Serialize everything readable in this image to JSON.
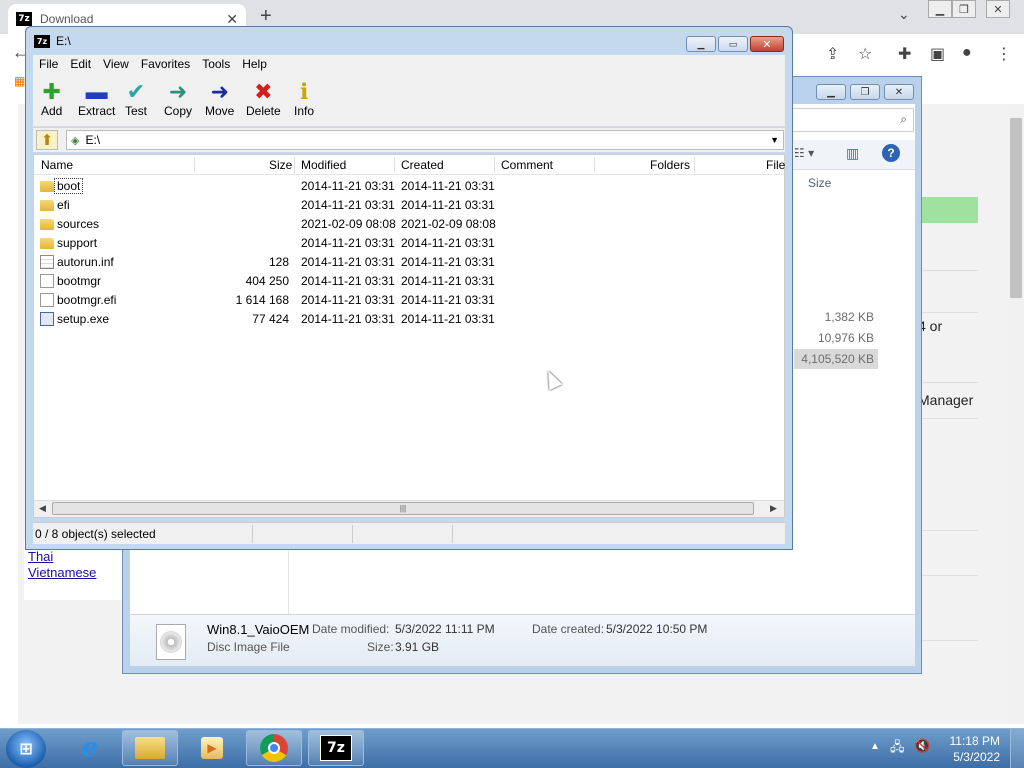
{
  "browser": {
    "tab_title": "Download",
    "tab_icon_text": "7z",
    "close_glyph": "✕",
    "new_tab_glyph": "+",
    "chevron_glyph": "⌄",
    "back_glyph": "←"
  },
  "page": {
    "languages": [
      "Thai",
      "Vietnamese"
    ],
    "side_texts": [
      "4 or",
      "Manager"
    ]
  },
  "explorer": {
    "column_size": "Size",
    "sizes": [
      "1,382 KB",
      "10,976 KB",
      "4,105,520 KB"
    ],
    "details": {
      "name": "Win8.1_VaioOEM",
      "type": "Disc Image File",
      "date_modified_label": "Date modified:",
      "date_modified": "5/3/2022 11:11 PM",
      "date_created_label": "Date created:",
      "date_created": "5/3/2022 10:50 PM",
      "size_label": "Size:",
      "size": "3.91 GB"
    }
  },
  "zip": {
    "title": "E:\\",
    "logo": "7z",
    "menu": [
      "File",
      "Edit",
      "View",
      "Favorites",
      "Tools",
      "Help"
    ],
    "tools": [
      {
        "label": "Add",
        "glyph": "✚",
        "color": "#2aa52a"
      },
      {
        "label": "Extract",
        "glyph": "▬",
        "color": "#1d3fbf"
      },
      {
        "label": "Test",
        "glyph": "✔",
        "color": "#28a6a6"
      },
      {
        "label": "Copy",
        "glyph": "➜",
        "color": "#2c8f7a"
      },
      {
        "label": "Move",
        "glyph": "➜",
        "color": "#1b2d9c"
      },
      {
        "label": "Delete",
        "glyph": "✖",
        "color": "#d41d1d"
      },
      {
        "label": "Info",
        "glyph": "ℹ",
        "color": "#c9a700"
      }
    ],
    "address": "E:\\",
    "columns": [
      "Name",
      "Size",
      "Modified",
      "Created",
      "Comment",
      "Folders",
      "File"
    ],
    "files": [
      {
        "name": "boot",
        "size": "",
        "modified": "2014-11-21 03:31",
        "created": "2014-11-21 03:31",
        "icon": "folder"
      },
      {
        "name": "efi",
        "size": "",
        "modified": "2014-11-21 03:31",
        "created": "2014-11-21 03:31",
        "icon": "folder"
      },
      {
        "name": "sources",
        "size": "",
        "modified": "2021-02-09 08:08",
        "created": "2021-02-09 08:08",
        "icon": "folder"
      },
      {
        "name": "support",
        "size": "",
        "modified": "2014-11-21 03:31",
        "created": "2014-11-21 03:31",
        "icon": "folder"
      },
      {
        "name": "autorun.inf",
        "size": "128",
        "modified": "2014-11-21 03:31",
        "created": "2014-11-21 03:31",
        "icon": "cfg"
      },
      {
        "name": "bootmgr",
        "size": "404 250",
        "modified": "2014-11-21 03:31",
        "created": "2014-11-21 03:31",
        "icon": "file"
      },
      {
        "name": "bootmgr.efi",
        "size": "1 614 168",
        "modified": "2014-11-21 03:31",
        "created": "2014-11-21 03:31",
        "icon": "file"
      },
      {
        "name": "setup.exe",
        "size": "77 424",
        "modified": "2014-11-21 03:31",
        "created": "2014-11-21 03:31",
        "icon": "exe"
      }
    ],
    "status": "0 / 8 object(s) selected"
  },
  "taskbar": {
    "time": "11:18 PM",
    "date": "5/3/2022",
    "zip_label": "7z",
    "ie_glyph": "e"
  }
}
